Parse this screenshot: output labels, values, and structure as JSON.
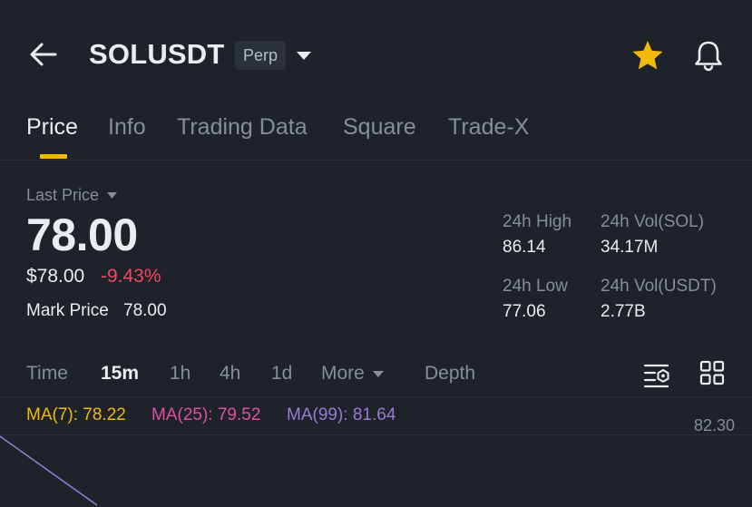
{
  "header": {
    "symbol": "SOLUSDT",
    "badge": "Perp",
    "icons": [
      "back-arrow-icon",
      "chevron-down-icon",
      "star-icon",
      "bell-icon"
    ],
    "favorite": true
  },
  "tabs": [
    {
      "label": "Price",
      "active": true
    },
    {
      "label": "Info"
    },
    {
      "label": "Trading Data"
    },
    {
      "label": "Square"
    },
    {
      "label": "Trade-X"
    }
  ],
  "price": {
    "label": "Last Price",
    "value": "78.00",
    "usd": "$78.00",
    "change": "-9.43%",
    "mark_label": "Mark Price",
    "mark_value": "78.00"
  },
  "stats": {
    "high_label": "24h High",
    "high_value": "86.14",
    "low_label": "24h Low",
    "low_value": "77.06",
    "vol_sol_label": "24h Vol(SOL)",
    "vol_sol_value": "34.17M",
    "vol_usdt_label": "24h Vol(USDT)",
    "vol_usdt_value": "2.77B"
  },
  "intervals": {
    "time": "Time",
    "m15": "15m",
    "h1": "1h",
    "h4": "4h",
    "d1": "1d",
    "more": "More",
    "depth": "Depth",
    "active": "15m"
  },
  "indicators": {
    "ma7": "MA(7): 78.22",
    "ma25": "MA(25): 79.52",
    "ma99": "MA(99): 81.64",
    "ma7_color": "#f0b90b",
    "ma25_color": "#e04fa6",
    "ma99_color": "#9b7ad6"
  },
  "chart": {
    "axis_label": "82.30"
  },
  "colors": {
    "background": "#1e2229",
    "accent": "#f0b90b",
    "negative": "#f6465d",
    "muted": "#848e9c"
  }
}
